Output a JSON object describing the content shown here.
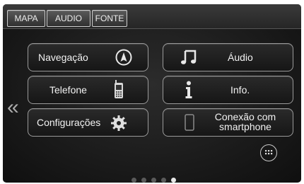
{
  "tabs": [
    {
      "label": "MAPA"
    },
    {
      "label": "AUDIO"
    },
    {
      "label": "FONTE"
    }
  ],
  "menu": {
    "navigation": "Navegação",
    "phone": "Telefone",
    "settings": "Configurações",
    "audio": "Áudio",
    "info": "Info.",
    "smartphone_line1": "Conexão com",
    "smartphone_line2": "smartphone"
  },
  "icons": {
    "navigation": "compass-icon",
    "phone": "phone-icon",
    "settings": "gear-icon",
    "audio": "music-note-icon",
    "info": "info-icon",
    "smartphone": "smartphone-icon",
    "back": "chevron-left-icon",
    "apps": "apps-grid-icon"
  },
  "pager": {
    "count": 5,
    "current": 5
  },
  "colors": {
    "background": "#1c1c1c",
    "button_border": "#9a9a9a",
    "text": "#f2f2f2"
  }
}
